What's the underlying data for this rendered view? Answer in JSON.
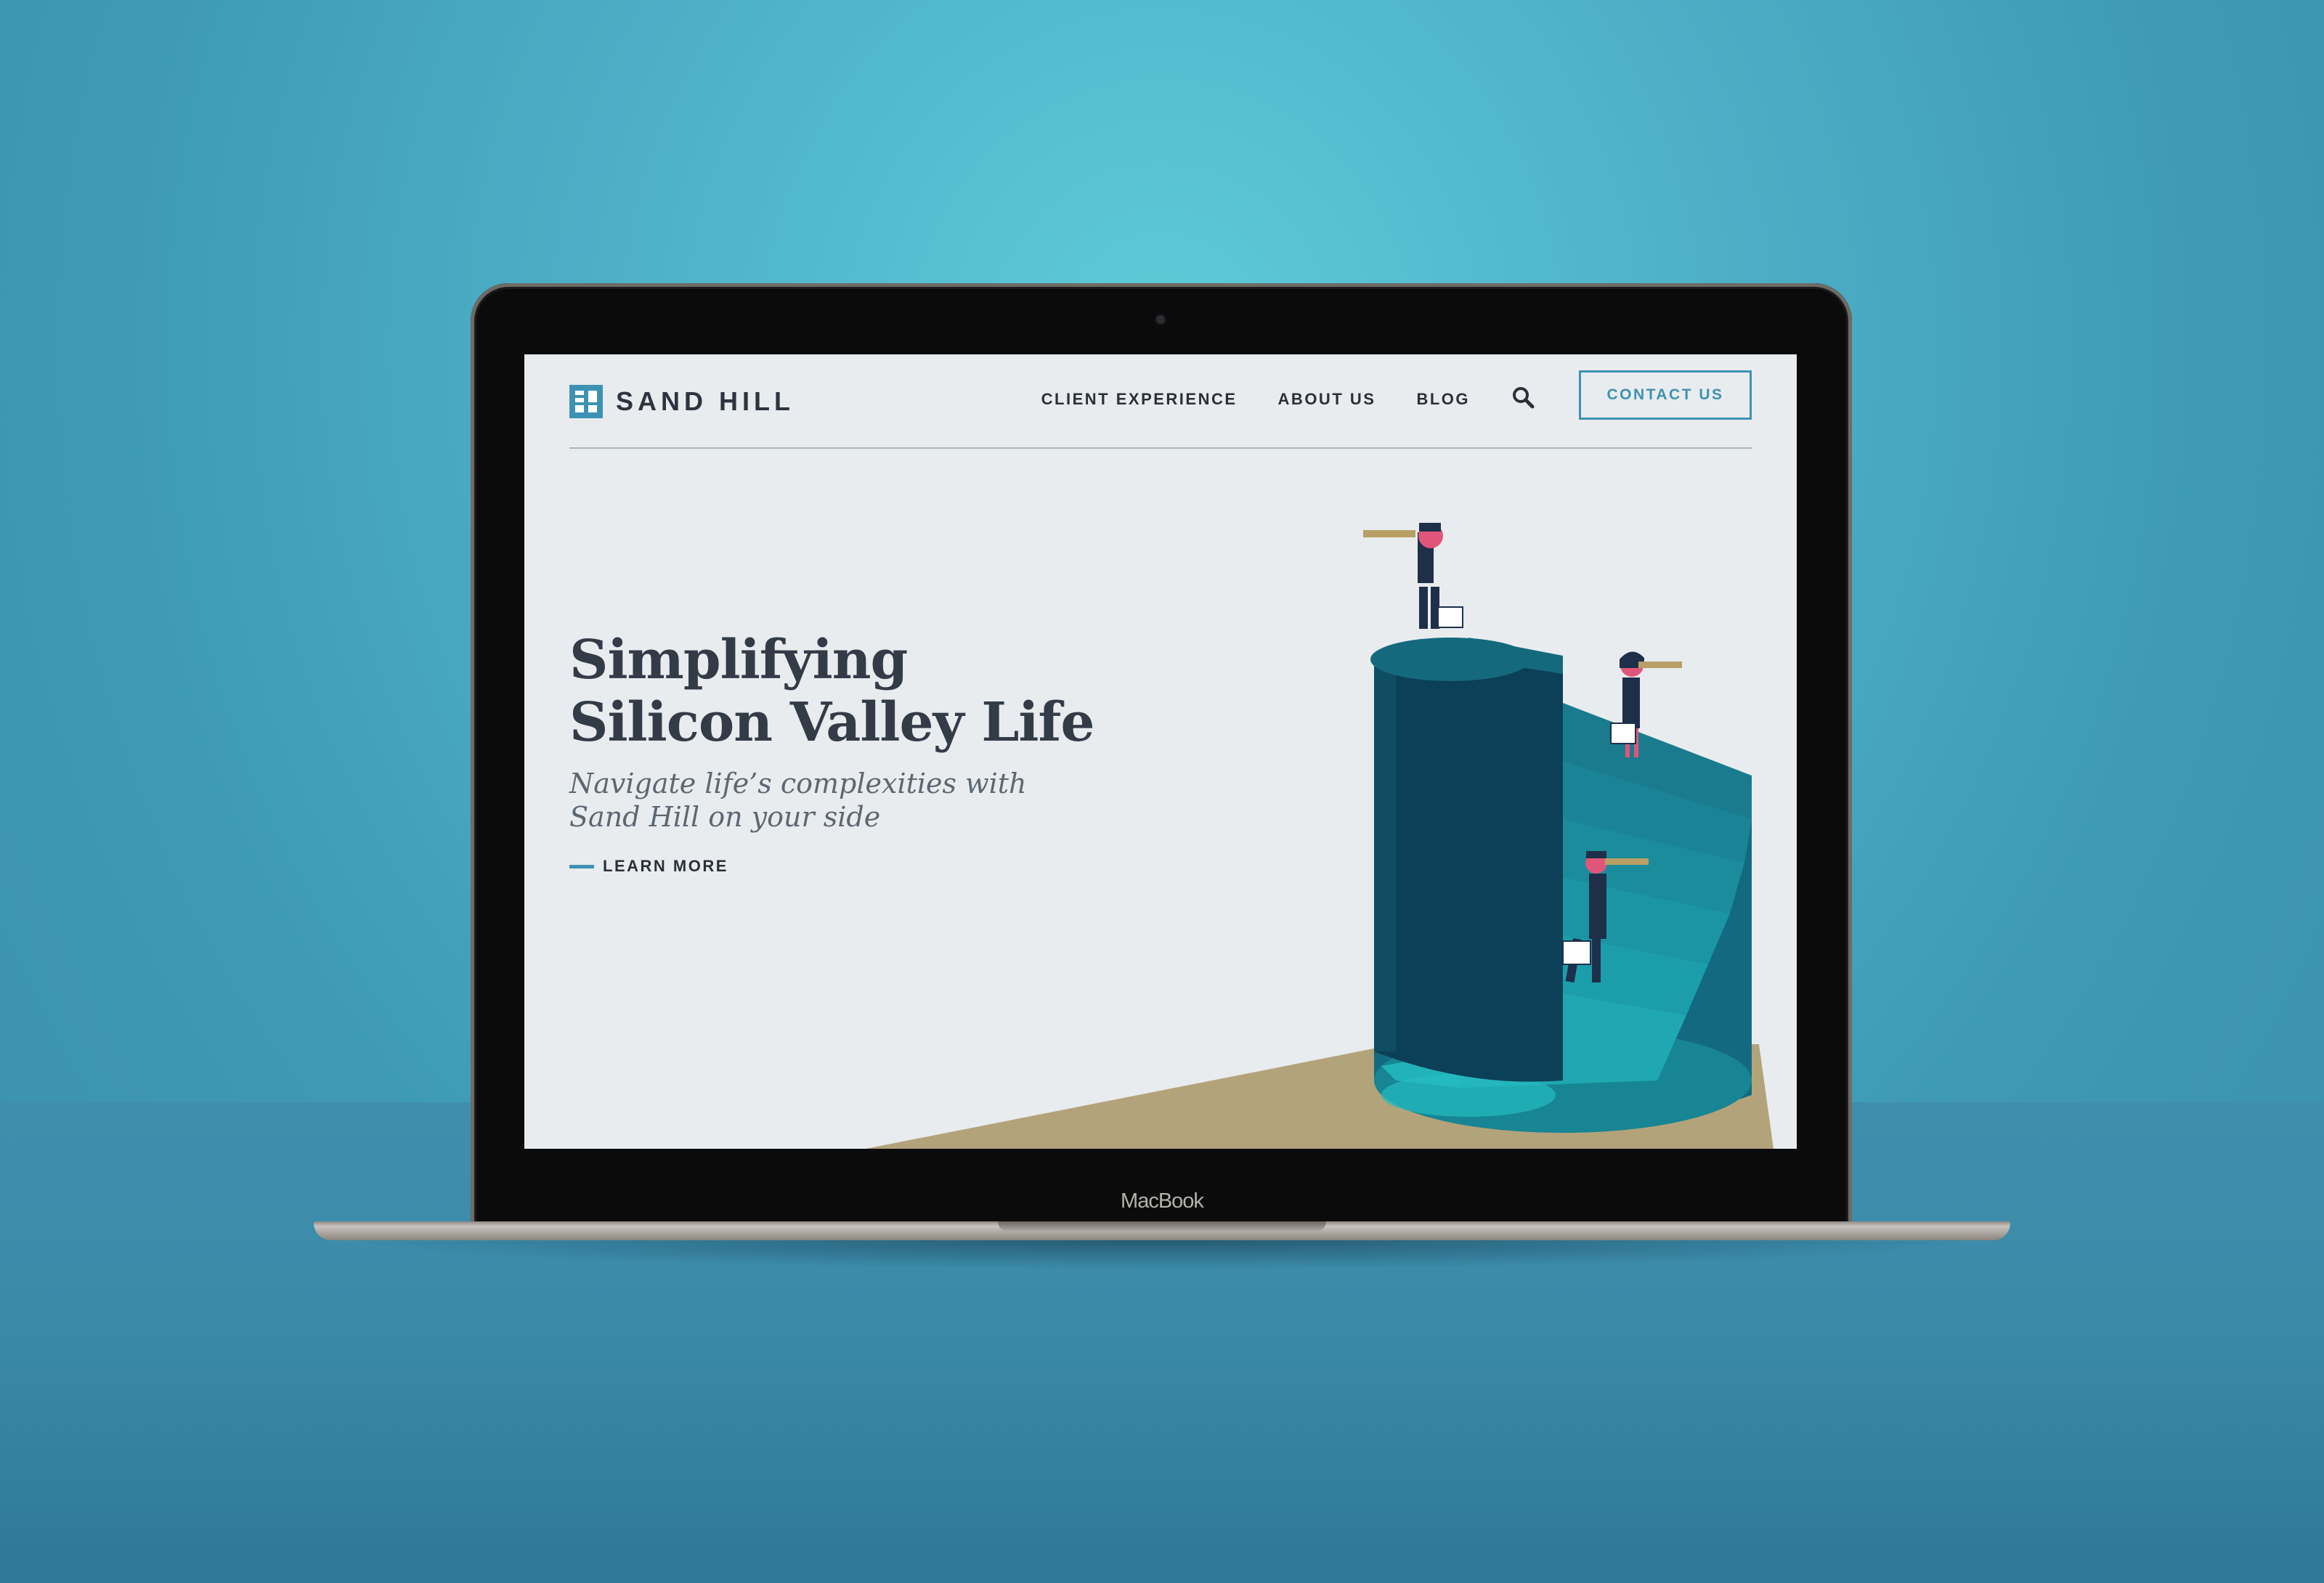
{
  "device": {
    "chin_label": "MacBook"
  },
  "nav": {
    "brand": "SAND HILL",
    "links": [
      "CLIENT EXPERIENCE",
      "ABOUT US",
      "BLOG"
    ],
    "contact_label": "CONTACT US"
  },
  "hero": {
    "title_line1": "Simplifying",
    "title_line2": "Silicon Valley Life",
    "subtitle": "Navigate life’s complexities with Sand Hill on your side",
    "cta_label": "LEARN MORE"
  },
  "colors": {
    "accent": "#3d92b3",
    "heading": "#333b47",
    "screen_bg": "#e8ecee",
    "ground": "#b3a37a",
    "teal_dark": "#0f4d63",
    "teal_light": "#1ea2ab"
  },
  "icons": {
    "search": "search-icon",
    "logo": "sand-hill-logo-icon"
  }
}
